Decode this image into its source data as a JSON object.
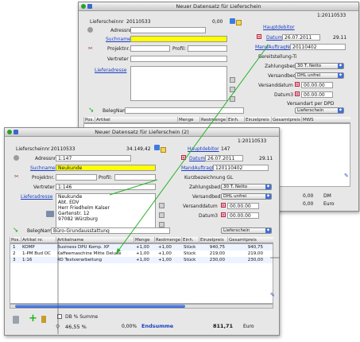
{
  "back": {
    "title": "Neuer Datensatz für Lieferschein",
    "record_id": "1:20110533",
    "ls_label": "Lieferscheinnr",
    "ls_value": "20110533",
    "amount": "0,00",
    "adress_label": "Adressnr.",
    "suchname_label": "Suchname",
    "projekt_label": "Projektnr.",
    "profil_label": "Profil:",
    "vertreter_label": "Vertreter",
    "lieferadresse_label": "Lieferadresse",
    "hauptdebitor": "Hauptdebitor",
    "datum_label": "Datum",
    "datum_value": "26.07.2011",
    "time_value": "29.11",
    "mandauftrag_label": "MandAuftragNr",
    "mandauftrag_value": "20110402",
    "bereitstellung_label": "Bereitstellung-Ti",
    "zahlung_label": "Zahlungsbed.",
    "zahlung_value": "30 T. Netto",
    "versand_label": "Versandbed.",
    "versand_value": "DHL unfrei",
    "versanddatum_label": "Versanddatum",
    "versanddatum_value": "00.00.00",
    "datum3_label": "Datum3",
    "datum3_value": "00.00.00",
    "versandart_label": "Versandart per DPD",
    "belegname_label": "BelegName",
    "lieferschein_label": "Lieferschein",
    "cols": [
      "Pos.",
      "Artikel",
      "Menge",
      "Restmenge",
      "Einh.",
      "Einzelpreis",
      "Gesamtpreis",
      "MWS"
    ],
    "sum_value": "0,00",
    "sum_currency": "DM",
    "sum_value2": "0,00",
    "sum_currency2": "Euro"
  },
  "front": {
    "title": "Neuer Datensatz für Lieferschein (2)",
    "record_id": "1:20110533",
    "ls_label": "Lieferscheinnr",
    "ls_value": "20110533",
    "amount": "34.149,42",
    "hauptdebitor_label": "Hauptdebitor",
    "hauptdebitor_value": "147",
    "adress_label": "Adressnr.",
    "adress_value": "1:147",
    "datum_label": "Datum",
    "datum_value": "26.07.2011",
    "time_value": "29.11",
    "suchname_label": "Suchname",
    "suchname_value": "Neukunde",
    "mandauftrag_label": "MandAuftragNr",
    "mandauftrag_value": "120110402",
    "projekt_label": "Projektnr.",
    "profil_label": "Profil:",
    "kurz_label": "Kurzbezeichnung GL",
    "vertreter_label": "Vertreter",
    "vertreter_value": "1:146",
    "zahlung_label": "Zahlungsbed.",
    "zahlung_value": "30 T. Netto",
    "lieferadresse_label": "Lieferadresse",
    "address_lines": [
      "Neukunde",
      "Abt. EDV",
      "Herr Friedhelm Kalser",
      "Gartenstr. 12",
      "97082 Würzburg"
    ],
    "versand_label": "Versandbed.",
    "versand_value": "DHL unfrei",
    "versanddatum_label": "Versanddatum",
    "versanddatum_value": "00.00.00",
    "datum3_label": "Datum3",
    "datum3_value": "00.00.00",
    "belegname_label": "BelegName",
    "belegname_value": "Büro-Grundausstattung",
    "lieferschein_label": "Lieferschein",
    "cols": [
      "Pos.",
      "Artikel nr.",
      "Artikelname",
      "Menge",
      "Restmenge",
      "Einh.",
      "Einzelpreis",
      "Gesamtpreis"
    ],
    "rows": [
      {
        "pos": "1",
        "nr": "KOMP",
        "name": "Business DPU Komp. XP",
        "menge": "+1,00",
        "rest": "+1,00",
        "einh": "Stück",
        "einzel": "940,75",
        "gesamt": "940,75"
      },
      {
        "pos": "2",
        "nr": "1-PM Bud OC",
        "name": "Kaffeemaschine Mitte Deluxe",
        "menge": "+1,00",
        "rest": "+1,00",
        "einh": "Stück",
        "einzel": "219,00",
        "gesamt": "219,00"
      },
      {
        "pos": "3",
        "nr": "1:16",
        "name": "4D Textverarbeitung",
        "menge": "+1,00",
        "rest": "+1,00",
        "einh": "Stück",
        "einzel": "230,00",
        "gesamt": "230,00"
      }
    ],
    "summe_label": "DB % Summe",
    "db_value": "46,55 %",
    "rabatt_value": "0,00%",
    "endsumme_label": "Endsumme",
    "endsumme_value": "811,71",
    "currency": "Euro"
  },
  "colors": {
    "accent_blue": "#1a3fc1",
    "highlight_yellow": "#ffff00",
    "arrow_green": "#1fb51f"
  }
}
